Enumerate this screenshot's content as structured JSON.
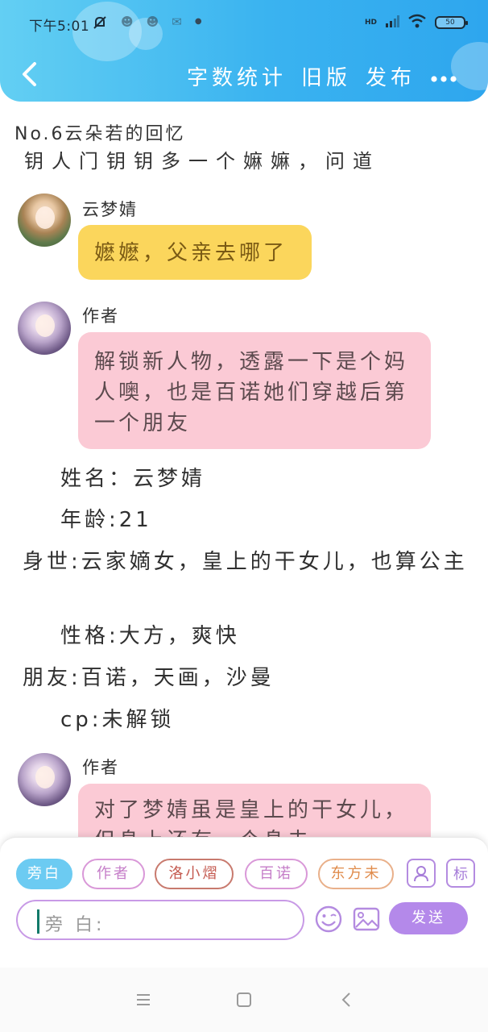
{
  "status_bar": {
    "time": "下午5:01",
    "left_icons": [
      "mute-bell-icon",
      "app-icon",
      "app-icon",
      "app-icon",
      "dot-icon"
    ],
    "network": "HD",
    "battery": "50"
  },
  "header": {
    "gradient_start": "#63cff3",
    "gradient_end": "#2ea6ee",
    "links": [
      "字数统计",
      "旧版",
      "发布"
    ]
  },
  "chapter": {
    "title": "No.6云朵若的回忆",
    "partial_line": "钥人门钥钥多一个嫲嫲，问道"
  },
  "messages": [
    {
      "speaker": "云梦婧",
      "text": "嬷嬷，父亲去哪了"
    },
    {
      "speaker": "作者",
      "text": "解锁新人物，透露一下是个妈人噢，也是百诺她们穿越后第一个朋友"
    },
    {
      "speaker": "作者",
      "text": "对了梦婧虽是皇上的干女儿，但身上还有一个身未"
    }
  ],
  "narration": [
    "姓名：云梦婧",
    "年龄:21",
    "身世:云家嫡女，皇上的干女儿，也算公主",
    "性格:大方，爽快",
    "朋友:百诺，天画，沙曼",
    "cp:未解锁"
  ],
  "roles": [
    {
      "label": "旁白",
      "color": "#6ccbf2"
    },
    {
      "label": "作者",
      "color": "#d998d8"
    },
    {
      "label": "洛小熠",
      "color": "#c87a6e"
    },
    {
      "label": "百诺",
      "color": "#d998d8"
    },
    {
      "label": "东方未",
      "color": "#e9b08a"
    }
  ],
  "input": {
    "placeholder": "旁 白:"
  },
  "send_label": "发送",
  "side_buttons": {
    "tag_label": "标"
  },
  "colors": {
    "yellow_bubble": "#fbd65c",
    "pink_bubble": "#fbcad5",
    "send_button": "#b489ea"
  }
}
